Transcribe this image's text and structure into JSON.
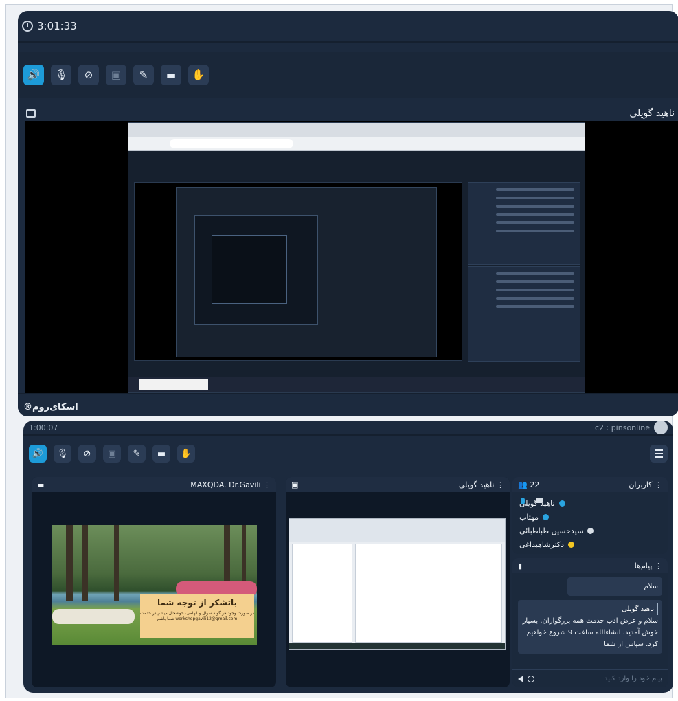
{
  "top": {
    "timer": "3:01:33",
    "presenter_name": "ناهید گویلی",
    "brand": "®اسکای‌روم",
    "toolbar": {
      "speaker_icon": "🔊",
      "mic_icon": "🎙",
      "camera_icon": "⊘",
      "screen_icon": "▣",
      "brush_icon": "✎",
      "folder_icon": "▬",
      "hand_icon": "✋"
    }
  },
  "bottom": {
    "timer": "1:00:07",
    "user_id": "c2 : pinsonline",
    "toolbar": {
      "speaker_icon": "🔊",
      "mic_icon": "🎙",
      "camera_icon": "⊘",
      "screen_icon": "▣",
      "brush_icon": "✎",
      "folder_icon": "▬",
      "hand_icon": "✋"
    },
    "maxqda_panel": {
      "title": "MAXQDA. Dr.Gavili",
      "slide_heading": "باتشکر از توجه شما",
      "slide_text": "در صورت وجود هر گونه سوال و ابهامی، خوشحال میشم در خدمت شما باشم workshopgavili12@gmail.com"
    },
    "share_panel": {
      "title": "ناهید گویلی"
    },
    "users_panel": {
      "title": "کاربران",
      "count": "22",
      "users": [
        "ناهید گویلی",
        "مهتاب",
        "سیدحسین طباطبائی",
        "دکترشاهبداغی"
      ]
    },
    "messages_panel": {
      "title": "پیام‌ها",
      "messages": [
        {
          "author": "",
          "text": "سلام"
        },
        {
          "author": "ناهید گویلی",
          "text": "سلام و عرض ادب خدمت همه بزرگواران. بسیار خوش آمدید. انشاءالله ساعت 9 شروع خواهیم کرد. سپاس از شما"
        }
      ],
      "input_placeholder": "پیام خود را وارد کنید"
    }
  }
}
